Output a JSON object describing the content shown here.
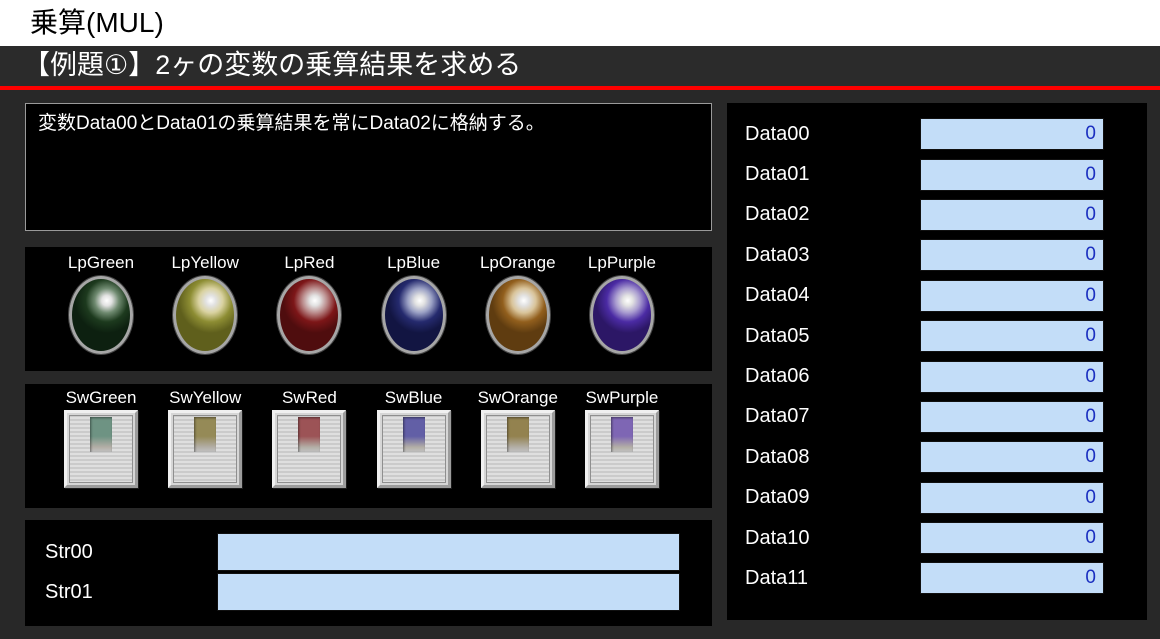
{
  "window": {
    "title": "乗算(MUL)"
  },
  "header": {
    "title": "【例題①】2ヶの変数の乗算結果を求める"
  },
  "description": {
    "text": "変数Data00とData01の乗算結果を常にData02に格納する。"
  },
  "lamps": [
    {
      "label": "LpGreen",
      "colors": {
        "light": "#6f8a70",
        "base": "#1d3a1e",
        "dark": "#0d2010"
      }
    },
    {
      "label": "LpYellow",
      "colors": {
        "light": "#d9d2a0",
        "base": "#8d8d33",
        "dark": "#5f5f1c"
      }
    },
    {
      "label": "LpRed",
      "colors": {
        "light": "#bb8d8d",
        "base": "#7d1618",
        "dark": "#4f0d0e"
      }
    },
    {
      "label": "LpBlue",
      "colors": {
        "light": "#9aa0c4",
        "base": "#252a6e",
        "dark": "#121542"
      }
    },
    {
      "label": "LpOrange",
      "colors": {
        "light": "#d9c49a",
        "base": "#925f1d",
        "dark": "#5f3c10"
      }
    },
    {
      "label": "LpPurple",
      "colors": {
        "light": "#a99cd0",
        "base": "#4b2ba4",
        "dark": "#2c1766"
      }
    }
  ],
  "switches": [
    {
      "label": "SwGreen",
      "slot_color": "#6e9383"
    },
    {
      "label": "SwYellow",
      "slot_color": "#958a57"
    },
    {
      "label": "SwRed",
      "slot_color": "#9c5356"
    },
    {
      "label": "SwBlue",
      "slot_color": "#625fa6"
    },
    {
      "label": "SwOrange",
      "slot_color": "#93824f"
    },
    {
      "label": "SwPurple",
      "slot_color": "#7e66b4"
    }
  ],
  "strings": [
    {
      "label": "Str00",
      "value": ""
    },
    {
      "label": "Str01",
      "value": ""
    }
  ],
  "data_registers": [
    {
      "label": "Data00",
      "value": "0"
    },
    {
      "label": "Data01",
      "value": "0"
    },
    {
      "label": "Data02",
      "value": "0"
    },
    {
      "label": "Data03",
      "value": "0"
    },
    {
      "label": "Data04",
      "value": "0"
    },
    {
      "label": "Data05",
      "value": "0"
    },
    {
      "label": "Data06",
      "value": "0"
    },
    {
      "label": "Data07",
      "value": "0"
    },
    {
      "label": "Data08",
      "value": "0"
    },
    {
      "label": "Data09",
      "value": "0"
    },
    {
      "label": "Data10",
      "value": "0"
    },
    {
      "label": "Data11",
      "value": "0"
    }
  ],
  "colors": {
    "page_bg": "#282828",
    "panel_bg": "#000000",
    "header_bg": "#2b2b2b",
    "accent_red": "#fe0000",
    "field_bg": "#c3ddf8",
    "field_text": "#1b2fc0"
  }
}
